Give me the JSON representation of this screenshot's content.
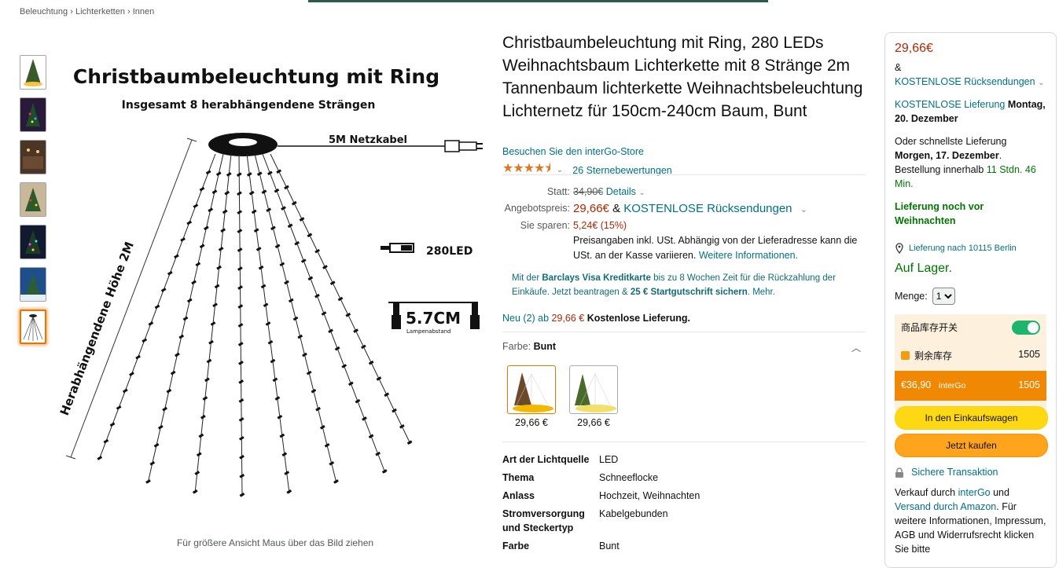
{
  "breadcrumb": [
    "Beleuchtung",
    "Lichterketten",
    "Innen"
  ],
  "image": {
    "title": "Christbaumbeleuchtung mit Ring",
    "subtitle": "Insgesamt 8 herabhängendene Strängen",
    "cable": "5M  Netzkabel",
    "height": "Herabhängendene Höhe 2M",
    "led": "280LED",
    "spacing": "5.7CM",
    "spacing_small": "Lampenabstand",
    "hint": "Für größere Ansicht Maus über das Bild ziehen"
  },
  "product": {
    "title": "Christbaumbeleuchtung mit Ring, 280 LEDs Weihnachtsbaum Lichterkette mit 8 Stränge 2m Tannenbaum lichterkette Weihnachtsbeleuchtung Lichternetz für 150cm-240cm Baum, Bunt",
    "store": "Besuchen Sie den interGo-Store",
    "stars": "★★★★⯨",
    "rating_count": "26 Sternebewertungen"
  },
  "price": {
    "statt_label": "Statt:",
    "statt_value": "34,90€",
    "details": "Details",
    "offer_label": "Angebotspreis:",
    "offer_value": "29,66€",
    "amp": "&",
    "returns": "KOSTENLOSE Rücksendungen",
    "save_label": "Sie sparen:",
    "save_value": "5,24€ (15%)",
    "vat_note": "Preisangaben inkl. USt. Abhängig von der Lieferadresse kann die USt. an der Kasse variieren.",
    "more_info": "Weitere Informationen."
  },
  "barclays": {
    "pre": "Mit der",
    "card": "Barclays Visa Kreditkarte",
    "mid": "bis zu 8 Wochen Zeit für die Rückzahlung der Einkäufe. Jetzt beantragen &",
    "bonus": "25 € Startgutschrift sichern",
    "more": "Mehr."
  },
  "new_offers": {
    "link": "Neu (2) ab",
    "price": "29,66 €",
    "shipping": "Kostenlose Lieferung."
  },
  "color": {
    "label": "Farbe:",
    "value": "Bunt",
    "options": [
      {
        "price": "29,66 €"
      },
      {
        "price": "29,66 €"
      }
    ]
  },
  "specs": [
    {
      "k": "Art der Lichtquelle",
      "v": "LED"
    },
    {
      "k": "Thema",
      "v": "Schneeflocke"
    },
    {
      "k": "Anlass",
      "v": "Hochzeit, Weihnachten"
    },
    {
      "k": "Stromversorgung und Steckertyp",
      "v": "Kabelgebunden"
    },
    {
      "k": "Farbe",
      "v": "Bunt"
    }
  ],
  "buybox": {
    "price": "29,66€",
    "amp": "&",
    "returns": "KOSTENLOSE Rücksendungen",
    "free_delivery": "KOSTENLOSE Lieferung",
    "delivery_date": "Montag, 20. Dezember",
    "fastest_pre": "Oder schnellste Lieferung",
    "fastest_date": "Morgen, 17. Dezember",
    "order_within": "Bestellung innerhalb",
    "countdown": "11 Stdn. 46 Min.",
    "before_xmas": "Lieferung noch vor Weihnachten",
    "deliver_to": "Lieferung nach 10115 Berlin",
    "in_stock": "Auf Lager.",
    "qty_label": "Menge:",
    "qty_value": "1",
    "plugin_toggle_label": "商品库存开关",
    "plugin_stock_label": "剩余库存",
    "plugin_stock_value": "1505",
    "plugin_price": "€36,90",
    "plugin_seller": "interGo",
    "plugin_qty": "1505",
    "add_to_cart": "In den Einkaufswagen",
    "buy_now": "Jetzt kaufen",
    "secure": "Sichere Transaktion",
    "seller_pre": "Verkauf durch",
    "seller": "interGo",
    "seller_and": "und",
    "fulfil": "Versand durch Amazon",
    "seller_post": ". Für weitere Informationen, Impressum, AGB und Widerrufsrecht klicken Sie bitte"
  }
}
